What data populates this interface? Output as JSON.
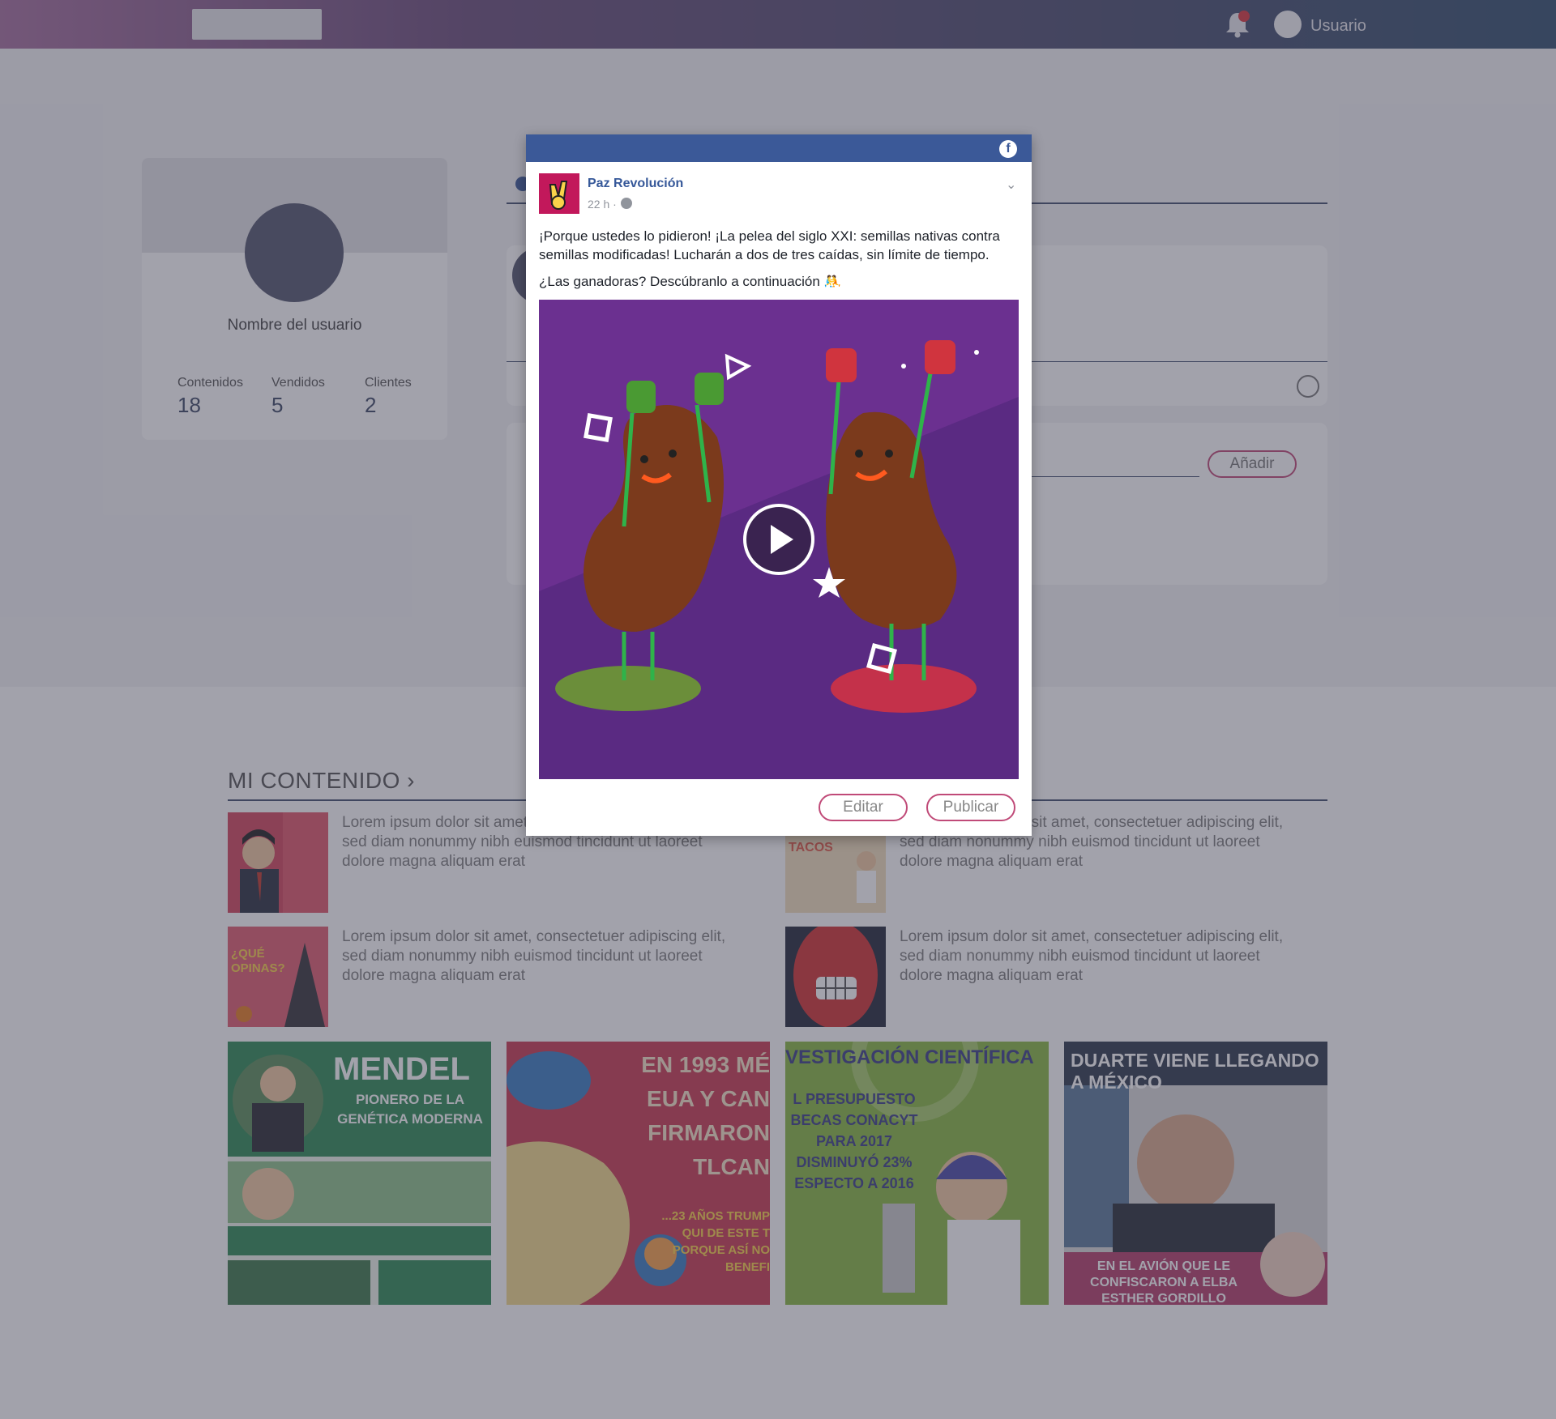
{
  "topbar": {
    "user_label": "Usuario"
  },
  "profile": {
    "name": "Nombre del usuario",
    "stats": [
      {
        "label": "Contenidos",
        "value": "18"
      },
      {
        "label": "Vendidos",
        "value": "5"
      },
      {
        "label": "Clientes",
        "value": "2"
      }
    ]
  },
  "composer": {
    "add_label": "Añadir"
  },
  "section": {
    "title": "MI CONTENIDO ›"
  },
  "content_items": [
    {
      "text": "Lorem ipsum dolor sit amet, consectetuer adipiscing elit, sed diam nonummy nibh euismod tincidunt ut laoreet dolore magna aliquam erat"
    },
    {
      "text": "Lorem ipsum dolor sit amet, consectetuer adipiscing elit, sed diam nonummy nibh euismod tincidunt ut laoreet dolore magna aliquam erat"
    },
    {
      "text": "Lorem ipsum dolor sit amet, consectetuer adipiscing elit, sed diam nonummy nibh euismod tincidunt ut laoreet dolore magna aliquam erat"
    },
    {
      "text": "Lorem ipsum dolor sit amet, consectetuer adipiscing elit, sed diam nonummy nibh euismod tincidunt ut laoreet dolore magna aliquam erat"
    }
  ],
  "thumb_texts": {
    "q": "¿QUÉ OPINAS?",
    "tacos": "TACOS"
  },
  "tiles": [
    {
      "headline": "MENDEL",
      "sub": "PIONERO DE LA GENÉTICA MODERNA",
      "color": "#2e8c57"
    },
    {
      "headline": "EN 1993 MÉ EUA Y CAN FIRMARON TLCAN",
      "sub": "...23 AÑOS TRUMP QUI DE ESTE T PORQUE ASÍ NO BENEFI",
      "color": "#c0334d"
    },
    {
      "headline": "VESTIGACIÓN CIENTÍFICA",
      "sub": "L PRESUPUESTO BECAS CONACYT PARA 2017 DISMINUYÓ 23% ESPECTO A 2016",
      "color": "#7fb23a"
    },
    {
      "headline": "DUARTE VIENE LLEGANDO A MÉXICO",
      "sub": "EN EL AVIÓN QUE LE CONFISCARON A ELBA ESTHER GORDILLO",
      "color": "#34495e"
    }
  ],
  "modal": {
    "page_name": "Paz Revolución",
    "time": "22 h ·",
    "text1": "¡Porque ustedes lo pidieron! ¡La pelea del siglo XXI: semillas nativas contra semillas modificadas! Lucharán a dos de tres caídas, sin límite de tiempo.",
    "text2": "¿Las ganadoras? Descúbranlo a continuación 🤼",
    "edit_label": "Editar",
    "publish_label": "Publicar"
  },
  "colors": {
    "fb_blue": "#3b5998",
    "accent": "#c04a78",
    "navy": "#41506e"
  }
}
